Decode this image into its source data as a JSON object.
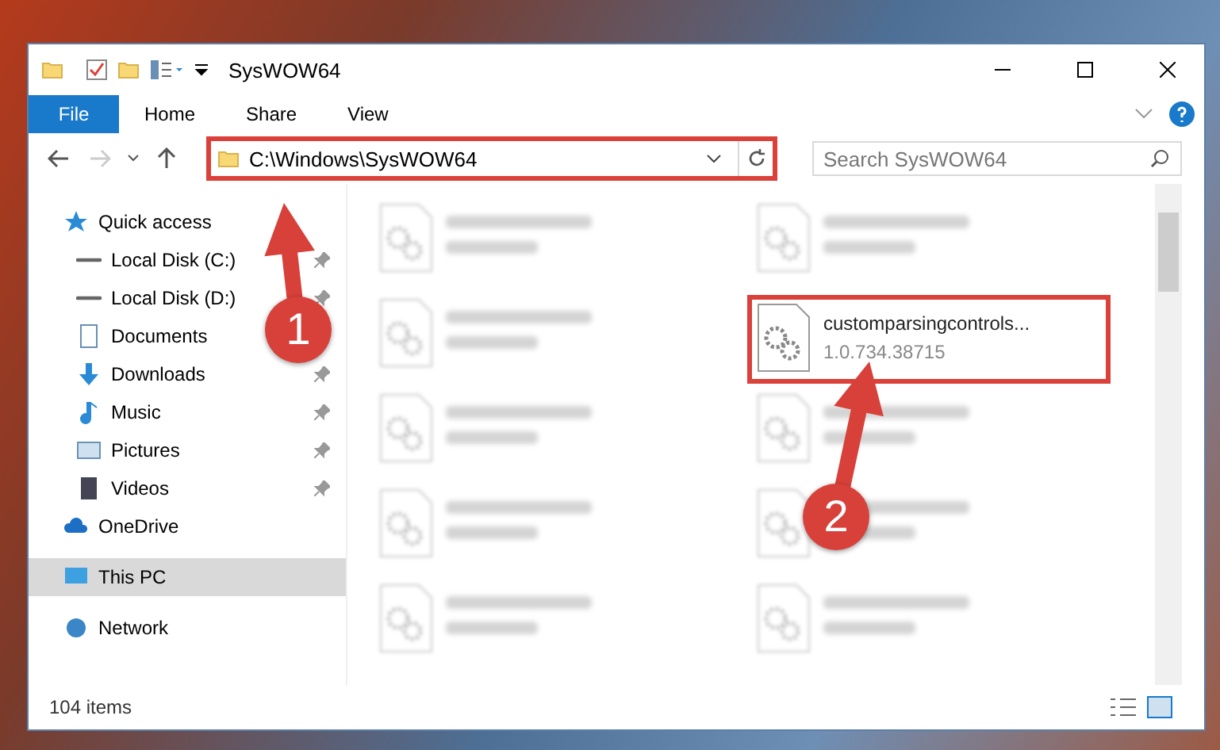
{
  "window": {
    "title": "SysWOW64"
  },
  "ribbon_tabs": [
    {
      "label": "File",
      "selected": true
    },
    {
      "label": "Home",
      "selected": false
    },
    {
      "label": "Share",
      "selected": false
    },
    {
      "label": "View",
      "selected": false
    }
  ],
  "address": {
    "path": "C:\\Windows\\SysWOW64",
    "highlighted": true
  },
  "search": {
    "placeholder": "Search SysWOW64"
  },
  "sidebar": {
    "items": [
      {
        "label": "Quick access",
        "selected": false,
        "children": [
          {
            "label": "Local Disk (C:)",
            "pinned": true,
            "selected": false
          },
          {
            "label": "Local Disk (D:)",
            "pinned": true,
            "selected": false
          },
          {
            "label": "Documents",
            "selected": false
          },
          {
            "label": "Downloads",
            "pinned": true,
            "selected": false
          },
          {
            "label": "Music",
            "pinned": true,
            "selected": false
          },
          {
            "label": "Pictures",
            "pinned": true,
            "selected": false
          },
          {
            "label": "Videos",
            "pinned": true,
            "selected": false
          }
        ]
      },
      {
        "label": "OneDrive",
        "selected": false
      },
      {
        "label": "This PC",
        "selected": true
      },
      {
        "label": "Network",
        "selected": false
      }
    ]
  },
  "files": [
    {
      "kind": "blurred"
    },
    {
      "kind": "blurred"
    },
    {
      "kind": "blurred"
    },
    {
      "kind": "file",
      "name": "customparsingcontrols...",
      "detail": "1.0.734.38715",
      "highlighted": true
    },
    {
      "kind": "blurred"
    },
    {
      "kind": "blurred"
    },
    {
      "kind": "blurred"
    },
    {
      "kind": "blurred"
    },
    {
      "kind": "blurred"
    },
    {
      "kind": "blurred"
    }
  ],
  "status_bar": {
    "count": "104 items"
  },
  "callouts": [
    {
      "number": "1"
    },
    {
      "number": "2"
    }
  ]
}
